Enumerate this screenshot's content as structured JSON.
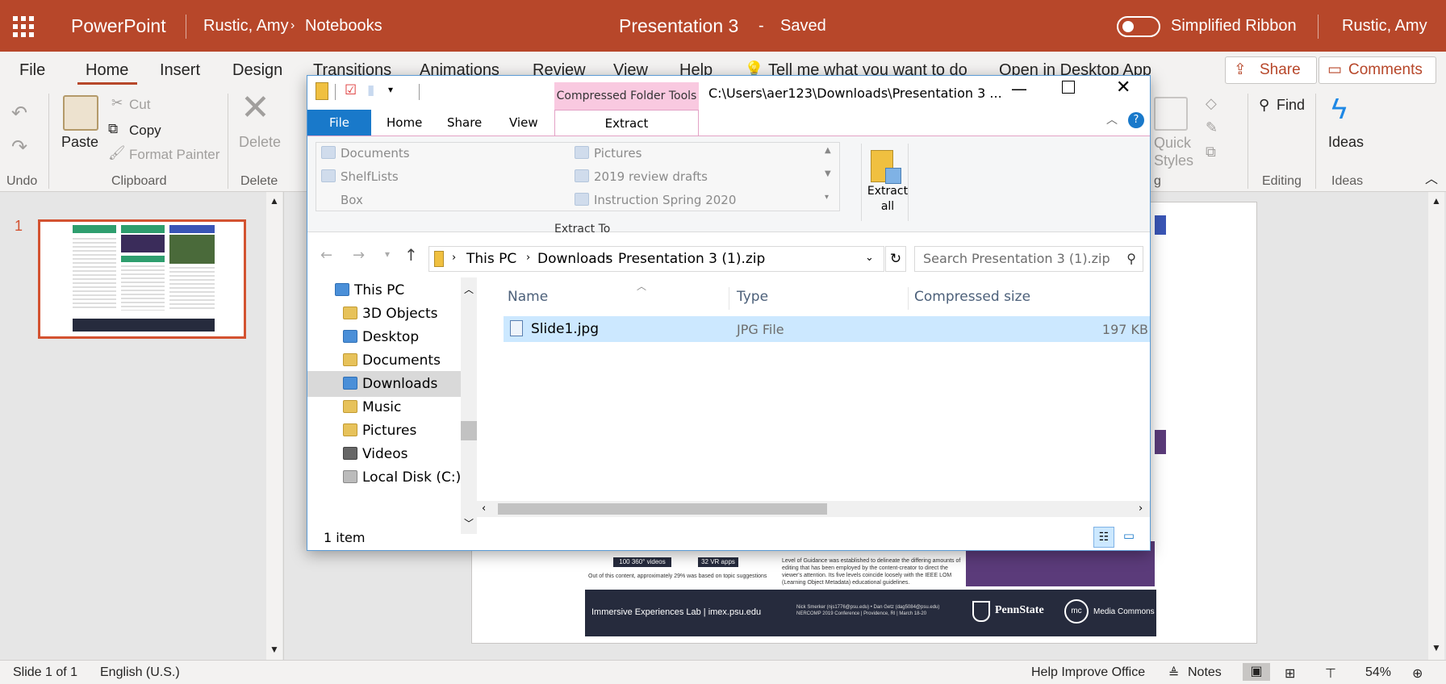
{
  "titlebar": {
    "app_name": "PowerPoint",
    "breadcrumb_user": "Rustic, Amy",
    "breadcrumb_folder": "Notebooks",
    "doc_title": "Presentation 3",
    "doc_sep": "-",
    "save_status": "Saved",
    "simplified_ribbon_label": "Simplified Ribbon",
    "user_name": "Rustic, Amy",
    "brand_color": "#b7472a"
  },
  "menu": {
    "tabs": [
      "File",
      "Home",
      "Insert",
      "Design",
      "Transitions",
      "Animations",
      "Review",
      "View",
      "Help"
    ],
    "active_tab": "Home",
    "tell_me": "Tell me what you want to do",
    "open_desktop": "Open in Desktop App",
    "share_label": "Share",
    "comments_label": "Comments"
  },
  "ribbon": {
    "undo_group": "Undo",
    "paste": "Paste",
    "cut": "Cut",
    "copy": "Copy",
    "format_painter": "Format Painter",
    "clipboard_group": "Clipboard",
    "delete": "Delete",
    "delete_group": "Delete",
    "quick_styles": "Quick Styles",
    "find": "Find",
    "editing_group": "Editing",
    "ideas": "Ideas",
    "ideas_group": "Ideas",
    "drawing_group_partial": "g"
  },
  "slides_pane": {
    "slide_number": "1"
  },
  "slide": {
    "footer_left": "Immersive Experiences Lab | imex.psu.edu",
    "footer_center": "Nick Smerker (njs1776@psu.edu) • Dan Getz (dag5084@psu.edu) NERCOMP 2019 Conference | Providence, RI | March 18-20",
    "pennstate": "PennState",
    "media_commons": "Media Commons",
    "badge_360": "100 360° videos",
    "badge_vr": "32 VR apps",
    "caption": "Out of this content, approximately 29% was based on topic suggestions",
    "guidance_text": "Level of Guidance was established to delineate the differing amounts of editing that has been employed by the content-creator to direct the viewer's attention. Its five levels coincide loosely with the IEEE LOM (Learning Object Metadata) educational guidelines."
  },
  "status": {
    "slide_info": "Slide 1 of 1",
    "language": "English (U.S.)",
    "help_improve": "Help Improve Office",
    "notes": "Notes",
    "zoom": "54%"
  },
  "explorer": {
    "window_title": "C:\\Users\\aer123\\Downloads\\Presentation 3 ...",
    "context_tab_group": "Compressed Folder Tools",
    "tabs": [
      "File",
      "Home",
      "Share",
      "View"
    ],
    "active_tab": "Extract",
    "extract_to_items": [
      "Documents",
      "Pictures",
      "ShelfLists",
      "2019 review drafts",
      "Box",
      "Instruction Spring 2020"
    ],
    "extract_to_label": "Extract To",
    "extract_all": "Extract all",
    "address_parts": [
      "This PC",
      "Downloads",
      "Presentation 3 (1).zip"
    ],
    "search_placeholder": "Search Presentation 3 (1).zip",
    "nav_items": [
      "This PC",
      "3D Objects",
      "Desktop",
      "Documents",
      "Downloads",
      "Music",
      "Pictures",
      "Videos",
      "Local Disk (C:)"
    ],
    "selected_nav": "Downloads",
    "columns": [
      "Name",
      "Type",
      "Compressed size"
    ],
    "files": [
      {
        "name": "Slide1.jpg",
        "type": "JPG File",
        "size": "197 KB"
      }
    ],
    "item_count": "1 item"
  }
}
